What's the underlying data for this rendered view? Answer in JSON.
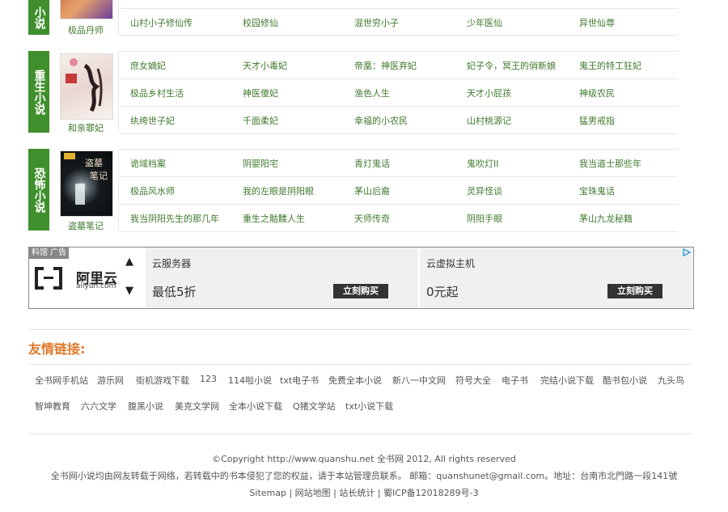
{
  "sections": [
    {
      "label": "小说",
      "cover_title": "极品丹师",
      "rows": [
        [
          "山村小子修仙传",
          "校园修仙",
          "混世穷小子",
          "少年医仙",
          "异世仙尊"
        ]
      ]
    },
    {
      "label": "重生小说",
      "cover_title": "和亲罪妃",
      "rows": [
        [
          "庶女嫡妃",
          "天才小毒妃",
          "帝凰：神医弃妃",
          "妃子令，冥王的俏新娘",
          "鬼王的特工狂妃"
        ],
        [
          "极品乡村生活",
          "神医傻妃",
          "渔色人生",
          "天才小屁孩",
          "神级农民"
        ],
        [
          "纨绔世子妃",
          "千面柔妃",
          "幸福的小农民",
          "山村桃源记",
          "猛男戒指"
        ]
      ]
    },
    {
      "label": "恐怖小说",
      "cover_title": "盗墓笔记",
      "rows": [
        [
          "诡域档案",
          "阴婴阳宅",
          "青灯鬼话",
          "鬼吹灯II",
          "我当道士那些年"
        ],
        [
          "极品风水师",
          "我的左眼是阴阳眼",
          "茅山后裔",
          "灵异怪谈",
          "宝珠鬼话"
        ],
        [
          "我当阴阳先生的那几年",
          "重生之骷髅人生",
          "天师传奇",
          "阴阳手眼",
          "茅山九龙秘籍"
        ]
      ]
    }
  ],
  "ad": {
    "tag": "料馆 广告",
    "brand": "阿里云",
    "brand_domain": "aliyun.com",
    "panels": [
      {
        "title": "云服务器",
        "price": "最低5折",
        "button": "立刻购买"
      },
      {
        "title": "云虚拟主机",
        "price": "0元起",
        "button": "立刻购买"
      }
    ]
  },
  "links": {
    "title": "友情链接:",
    "row1": [
      "全书网手机站",
      "游乐网",
      "街机游戏下载",
      "123",
      "114啦小说",
      "txt电子书",
      "免费全本小说",
      "新八一中文网",
      "符号大全",
      "电子书",
      "完结小说下载",
      "酷书包小说",
      "九头鸟"
    ],
    "row2": [
      "智坤教育",
      "六六文学",
      "腹黑小说",
      "美克文学网",
      "全本小说下载",
      "Q猪文学站",
      "txt小说下载"
    ]
  },
  "footer": {
    "copyright": "©Copyright http://www.quanshu.net 全书网 2012, All rights reserved",
    "notice": "全书网小说均由网友转载于网络，若转载中的书本侵犯了您的权益，请于本站管理员联系。 邮箱：quanshunet@gmail.com。地址：台南市北門路一段141號",
    "nav": "Sitemap | 网站地图 | 站长统计 | 蜀ICP备12018289号-3"
  },
  "colors": {
    "green_label": "#3f8f2c",
    "link_green": "#3f7a2e",
    "links_title": "#e07a2c"
  }
}
